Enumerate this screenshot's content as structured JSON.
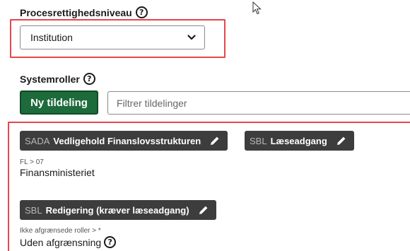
{
  "access_level": {
    "label": "Procesrettighedsniveau",
    "help": "?",
    "selected": "Institution"
  },
  "system_roles": {
    "label": "Systemroller",
    "help": "?",
    "new_button": "Ny tildeling",
    "filter_placeholder": "Filtrer tildelinger"
  },
  "assignments": [
    {
      "chips": [
        {
          "system": "SADA",
          "name": "Vedligehold Finanslovsstrukturen"
        },
        {
          "system": "SBL",
          "name": "Læseadgang"
        }
      ],
      "scope_path": "FL > 07",
      "scope_value": "Finansministeriet"
    },
    {
      "chips": [
        {
          "system": "SBL",
          "name": "Redigering (kræver læseadgang)"
        }
      ],
      "scope_path": "Ikke afgrænsede roller > *",
      "scope_value": "Uden afgrænsning",
      "scope_help": "?"
    }
  ],
  "colors": {
    "highlight": "#e4474d",
    "button_green": "#1d6b3b",
    "chip_bg": "#3d3d3d"
  }
}
